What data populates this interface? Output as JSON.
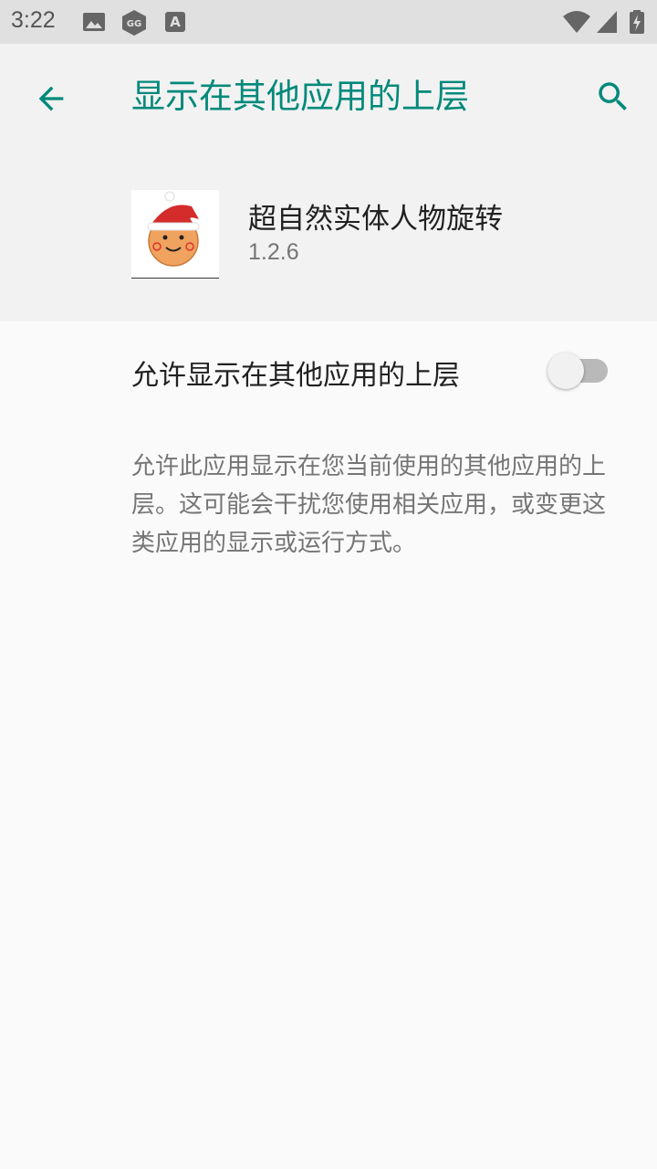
{
  "status_bar": {
    "time": "3:22",
    "left_icons": [
      "image-icon",
      "game-guardian-icon",
      "accessibility-a-icon"
    ],
    "right_icons": [
      "wifi-icon",
      "cell-signal-icon",
      "battery-charging-icon"
    ]
  },
  "toolbar": {
    "title": "显示在其他应用的上层",
    "back_icon": "arrow-back-icon",
    "search_icon": "search-icon",
    "accent_color": "#00897b"
  },
  "app": {
    "name": "超自然实体人物旋转",
    "version": "1.2.6",
    "icon": "santa-hat-emoji-icon"
  },
  "setting": {
    "label": "允许显示在其他应用的上层",
    "enabled": false
  },
  "description": "允许此应用显示在您当前使用的其他应用的上层。这可能会干扰您使用相关应用，或变更这类应用的显示或运行方式。"
}
